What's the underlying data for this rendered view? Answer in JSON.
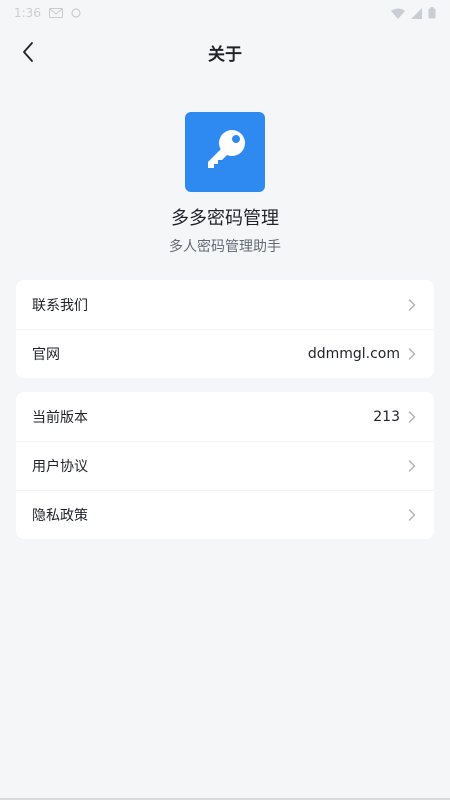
{
  "status_bar": {
    "time": "1:36"
  },
  "nav": {
    "title": "关于"
  },
  "app": {
    "name": "多多密码管理",
    "subtitle": "多人密码管理助手",
    "logo_icon": "key-icon",
    "brand_color": "#2e8af0"
  },
  "card1": {
    "rows": [
      {
        "label": "联系我们",
        "value": ""
      },
      {
        "label": "官网",
        "value": "ddmmgl.com"
      }
    ]
  },
  "card2": {
    "rows": [
      {
        "label": "当前版本",
        "value": "213"
      },
      {
        "label": "用户协议",
        "value": ""
      },
      {
        "label": "隐私政策",
        "value": ""
      }
    ]
  },
  "icons": {
    "back": "chevron-left-icon",
    "row_arrow": "chevron-right-icon"
  }
}
